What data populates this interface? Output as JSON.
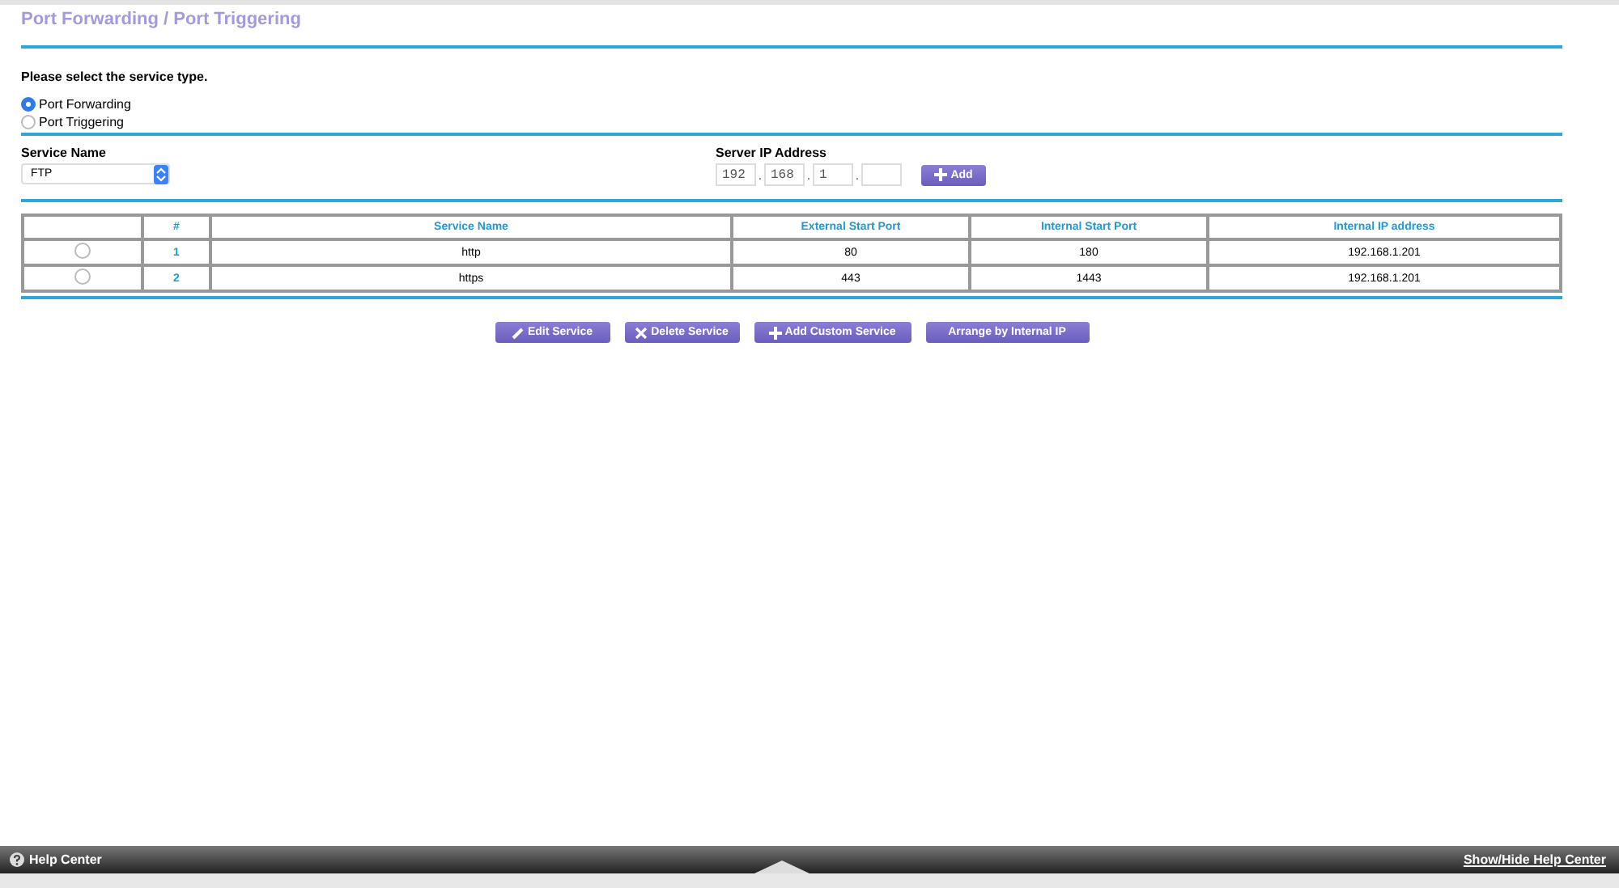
{
  "title": "Port Forwarding / Port Triggering",
  "service_type": {
    "prompt": "Please select the service type.",
    "options": [
      {
        "label": "Port Forwarding",
        "selected": true
      },
      {
        "label": "Port Triggering",
        "selected": false
      }
    ]
  },
  "service_name": {
    "label": "Service Name",
    "value": "FTP"
  },
  "server_ip": {
    "label": "Server IP Address",
    "octets": [
      "192",
      "168",
      "1"
    ],
    "separators": [
      ".",
      ".",
      "."
    ],
    "add_button": "Add"
  },
  "table": {
    "columns": [
      "#",
      "Service Name",
      "External Start Port",
      "Internal Start Port",
      "Internal IP address"
    ],
    "rows": [
      {
        "selected": false,
        "cells": [
          "1",
          "http",
          "80",
          "180",
          "192.168.1.201"
        ]
      },
      {
        "selected": false,
        "cells": [
          "2",
          "https",
          "443",
          "1443",
          "192.168.1.201"
        ]
      }
    ]
  },
  "buttons": [
    "Edit Service",
    "Delete Service",
    "Add Custom Service",
    "Arrange by Internal IP"
  ],
  "help_bar": {
    "left": "Help Center",
    "right": "Show/Hide Help Center"
  }
}
